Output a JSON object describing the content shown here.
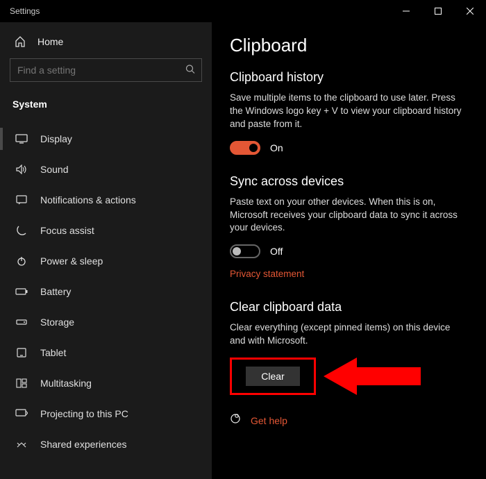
{
  "window": {
    "title": "Settings"
  },
  "sidebar": {
    "home_label": "Home",
    "search_placeholder": "Find a setting",
    "category_label": "System",
    "items": [
      {
        "label": "Display"
      },
      {
        "label": "Sound"
      },
      {
        "label": "Notifications & actions"
      },
      {
        "label": "Focus assist"
      },
      {
        "label": "Power & sleep"
      },
      {
        "label": "Battery"
      },
      {
        "label": "Storage"
      },
      {
        "label": "Tablet"
      },
      {
        "label": "Multitasking"
      },
      {
        "label": "Projecting to this PC"
      },
      {
        "label": "Shared experiences"
      }
    ]
  },
  "main": {
    "title": "Clipboard",
    "history": {
      "heading": "Clipboard history",
      "desc": "Save multiple items to the clipboard to use later. Press the Windows logo key + V to view your clipboard history and paste from it.",
      "toggle_state": "On"
    },
    "sync": {
      "heading": "Sync across devices",
      "desc": "Paste text on your other devices. When this is on, Microsoft receives your clipboard data to sync it across your devices.",
      "toggle_state": "Off",
      "privacy_link": "Privacy statement"
    },
    "clear": {
      "heading": "Clear clipboard data",
      "desc": "Clear everything (except pinned items) on this device and with Microsoft.",
      "button_label": "Clear"
    },
    "help_label": "Get help"
  },
  "annotation": {
    "accent_color": "#e45735",
    "highlight_color": "#ff0000"
  }
}
